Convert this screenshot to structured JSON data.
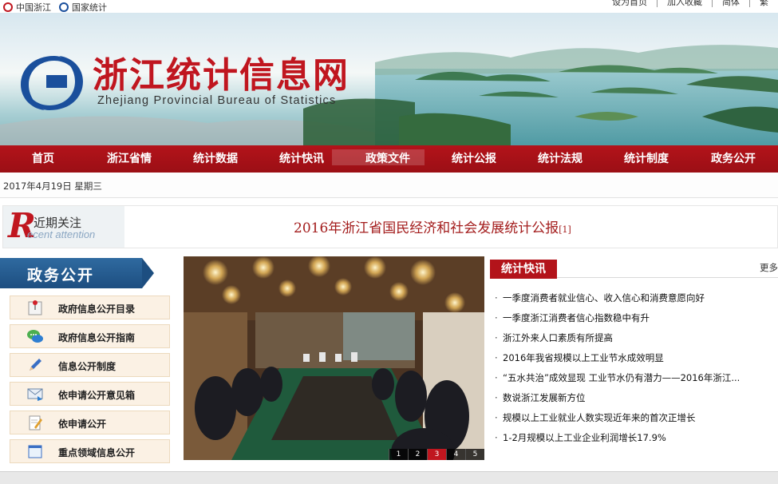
{
  "topbar": {
    "left_links": [
      "中国浙江",
      "国家统计"
    ],
    "right_links": [
      "设为首页",
      "加入收藏",
      "简体",
      "繁"
    ]
  },
  "header": {
    "title": "浙江统计信息网",
    "subtitle": "Zhejiang Provincial Bureau of Statistics"
  },
  "nav": {
    "items": [
      "首页",
      "浙江省情",
      "统计数据",
      "统计快讯",
      "政策文件",
      "统计公报",
      "统计法规",
      "统计制度",
      "政务公开"
    ]
  },
  "date_line": "2017年4月19日  星期三",
  "focus": {
    "badge_cn": "近期关注",
    "badge_en": "ecent attention",
    "badge_letter": "R",
    "headline": "2016年浙江省国民经济和社会发展统计公报",
    "headline_mark": "[1]"
  },
  "gov": {
    "title": "政务公开",
    "items": [
      {
        "label": "政府信息公开目录",
        "icon": "pin-board-icon"
      },
      {
        "label": "政府信息公开指南",
        "icon": "chat-bubbles-icon"
      },
      {
        "label": "信息公开制度",
        "icon": "pencil-icon"
      },
      {
        "label": "依申请公开意见箱",
        "icon": "envelope-icon"
      },
      {
        "label": "依申请公开",
        "icon": "edit-document-icon"
      },
      {
        "label": "重点领域信息公开",
        "icon": "window-icon"
      }
    ]
  },
  "slideshow": {
    "pages": [
      "1",
      "2",
      "3",
      "4",
      "5"
    ],
    "active": "3"
  },
  "news": {
    "tab": "统计快讯",
    "more": "更多",
    "items": [
      "一季度消费者就业信心、收入信心和消费意愿向好",
      "一季度浙江消费者信心指数稳中有升",
      "浙江外来人口素质有所提高",
      "2016年我省规模以上工业节水成效明显",
      "“五水共治”成效显现  工业节水仍有潜力——2016年浙江...",
      "数说浙江发展新方位",
      "规模以上工业就业人数实现近年来的首次正增长",
      "1-2月规模以上工业企业利润增长17.9%"
    ]
  },
  "colors": {
    "brand_red": "#b3131a",
    "gov_blue": "#1d4e80"
  }
}
